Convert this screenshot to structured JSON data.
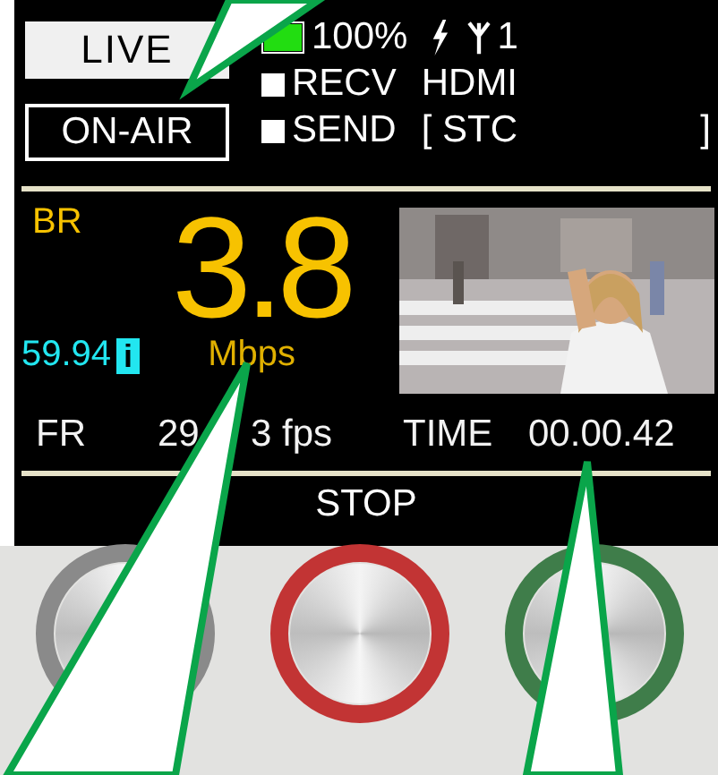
{
  "status": {
    "mode": "LIVE",
    "on_air": "ON-AIR",
    "battery": {
      "level": 1,
      "reading": "100%"
    },
    "antenna_count": "1",
    "recv": {
      "label": "RECV",
      "value": "HDMI"
    },
    "send": {
      "label": "SEND",
      "value": "[ STC",
      "end": "]"
    }
  },
  "bitrate": {
    "label": "BR",
    "value": "3.8",
    "unit": "Mbps",
    "frame_rate": "59.94",
    "scan": "i"
  },
  "fr": {
    "label": "FR",
    "value": "29",
    "value_rest": "3 fps"
  },
  "time": {
    "label": "TIME",
    "value": "00.00.42"
  },
  "state": "STOP",
  "buttons": [
    {
      "color": "#8a8a8a"
    },
    {
      "color": "#c23434"
    },
    {
      "color": "#3f7d4a"
    }
  ]
}
